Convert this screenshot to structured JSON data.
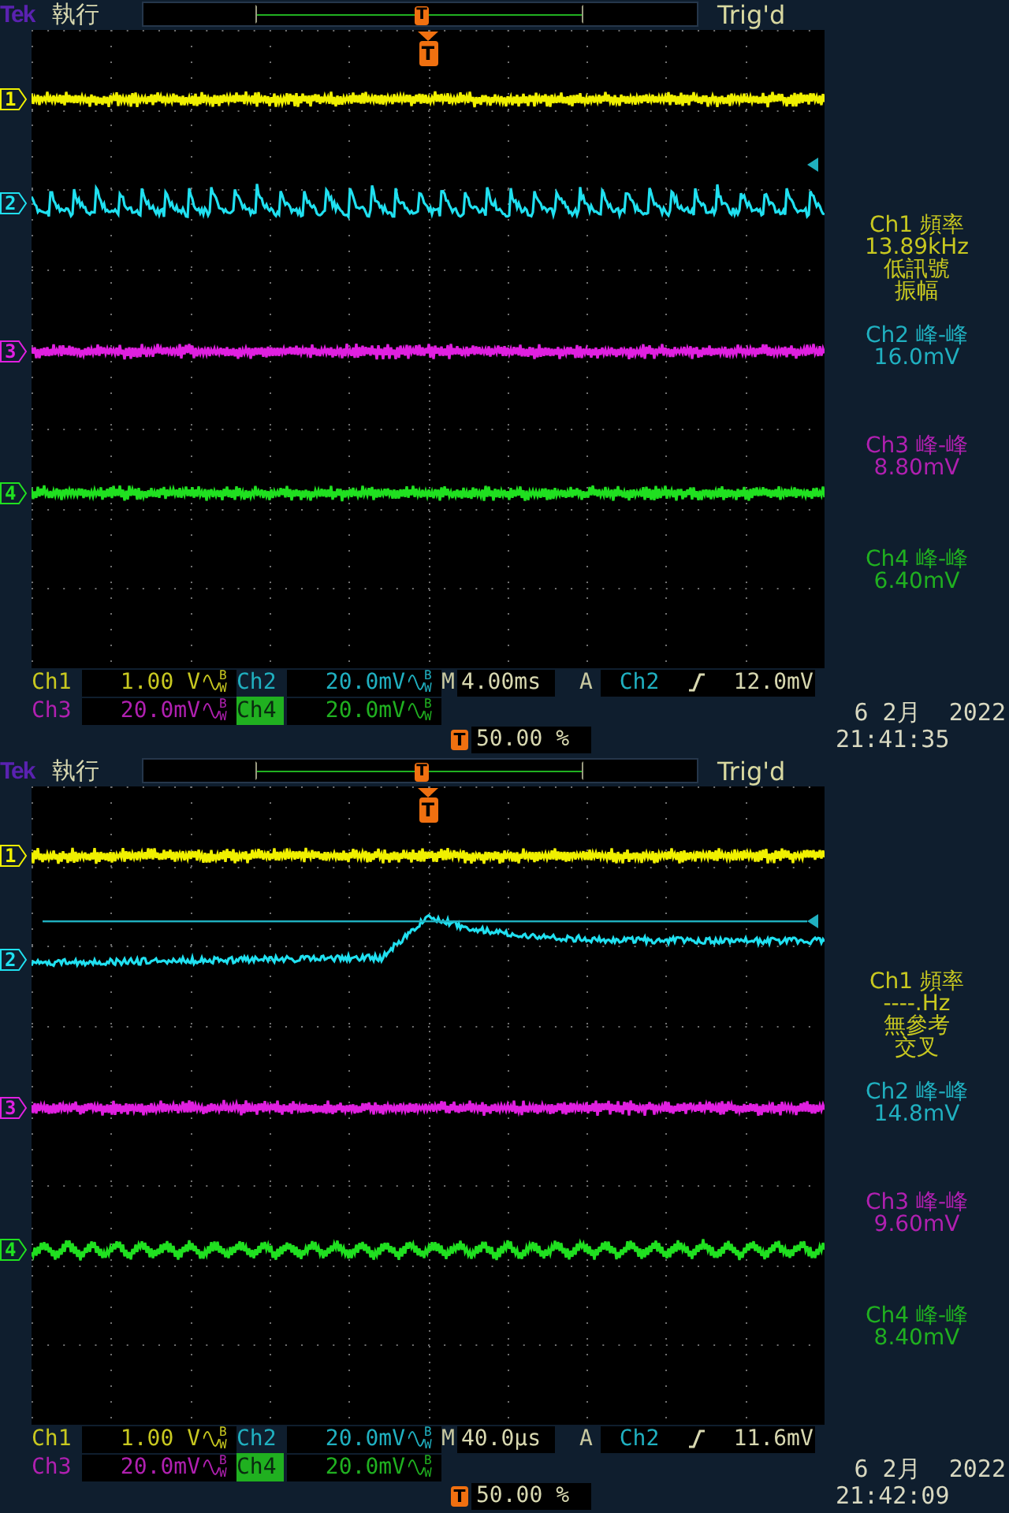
{
  "screens": [
    {
      "header": {
        "brand": "Tek",
        "run_state": "執行",
        "position_marker": "T",
        "trigger_state": "Trig'd"
      },
      "trigger_marker": "T",
      "trigger_level_line": false,
      "traces": [
        {
          "marker": "1",
          "color": "#f0f000",
          "kind": "noise"
        },
        {
          "marker": "2",
          "color": "#20e0f0",
          "kind": "sawtooth"
        },
        {
          "marker": "3",
          "color": "#e020e0",
          "kind": "noise"
        },
        {
          "marker": "4",
          "color": "#20e020",
          "kind": "noise"
        }
      ],
      "measurements": [
        {
          "color": "#c8c820",
          "lines": [
            "Ch1 頻率",
            "13.89kHz",
            "低訊號",
            "振幅"
          ]
        },
        {
          "color": "#20b0c0",
          "lines": [
            "Ch2 峰-峰",
            "16.0mV"
          ]
        },
        {
          "color": "#b020b0",
          "lines": [
            "Ch3 峰-峰",
            "8.80mV"
          ]
        },
        {
          "color": "#20b020",
          "lines": [
            "Ch4 峰-峰",
            "6.40mV"
          ]
        }
      ],
      "channels": [
        {
          "label": "Ch1",
          "scale": "1.00 V",
          "bw": "BW",
          "color": "#c8c820",
          "selected": false
        },
        {
          "label": "Ch2",
          "scale": "20.0mV",
          "bw": "BW",
          "color": "#20b0c0",
          "selected": false
        },
        {
          "label": "Ch3",
          "scale": "20.0mV",
          "bw": "BW",
          "color": "#b020b0",
          "selected": false
        },
        {
          "label": "Ch4",
          "scale": "20.0mV",
          "bw": "BW",
          "color": "#20b020",
          "selected": true
        }
      ],
      "timebase": {
        "label": "M",
        "value": "4.00ms"
      },
      "trigger": {
        "mode": "A",
        "source": "Ch2",
        "level": "12.0mV"
      },
      "trigger_position": {
        "marker": "T",
        "value": "50.00 %"
      },
      "date": "6 2月  2022",
      "time": "21:41:35"
    },
    {
      "header": {
        "brand": "Tek",
        "run_state": "執行",
        "position_marker": "T",
        "trigger_state": "Trig'd"
      },
      "trigger_marker": "T",
      "trigger_level_line": true,
      "traces": [
        {
          "marker": "1",
          "color": "#f0f000",
          "kind": "noise"
        },
        {
          "marker": "2",
          "color": "#20e0f0",
          "kind": "step"
        },
        {
          "marker": "3",
          "color": "#e020e0",
          "kind": "noise"
        },
        {
          "marker": "4",
          "color": "#20e020",
          "kind": "ripple"
        }
      ],
      "measurements": [
        {
          "color": "#c8c820",
          "lines": [
            "Ch1 頻率",
            "----.Hz",
            "無參考",
            "交叉"
          ]
        },
        {
          "color": "#20b0c0",
          "lines": [
            "Ch2 峰-峰",
            "14.8mV"
          ]
        },
        {
          "color": "#b020b0",
          "lines": [
            "Ch3 峰-峰",
            "9.60mV"
          ]
        },
        {
          "color": "#20b020",
          "lines": [
            "Ch4 峰-峰",
            "8.40mV"
          ]
        }
      ],
      "channels": [
        {
          "label": "Ch1",
          "scale": "1.00 V",
          "bw": "BW",
          "color": "#c8c820",
          "selected": false
        },
        {
          "label": "Ch2",
          "scale": "20.0mV",
          "bw": "BW",
          "color": "#20b0c0",
          "selected": false
        },
        {
          "label": "Ch3",
          "scale": "20.0mV",
          "bw": "BW",
          "color": "#b020b0",
          "selected": false
        },
        {
          "label": "Ch4",
          "scale": "20.0mV",
          "bw": "BW",
          "color": "#20b020",
          "selected": true
        }
      ],
      "timebase": {
        "label": "M",
        "value": "40.0µs"
      },
      "trigger": {
        "mode": "A",
        "source": "Ch2",
        "level": "11.6mV"
      },
      "trigger_position": {
        "marker": "T",
        "value": "50.00 %"
      },
      "date": "6 2月  2022",
      "time": "21:42:09"
    }
  ]
}
